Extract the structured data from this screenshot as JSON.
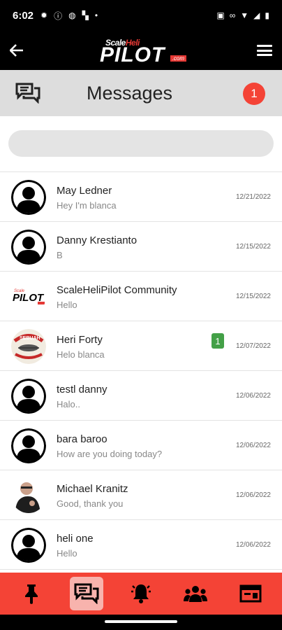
{
  "status": {
    "time": "6:02"
  },
  "app_bar": {
    "logo_top_a": "Scale",
    "logo_top_b": "Heli",
    "logo_main": "PILOT",
    "logo_com": ".com"
  },
  "header": {
    "title": "Messages",
    "badge": "1"
  },
  "search": {
    "placeholder": "",
    "value": ""
  },
  "conversations": [
    {
      "name": "May Ledner",
      "preview": "Hey I'm blanca",
      "date": "12/21/2022",
      "avatar": "silhouette",
      "unread": ""
    },
    {
      "name": "Danny Krestianto",
      "preview": "B",
      "date": "12/15/2022",
      "avatar": "silhouette",
      "unread": ""
    },
    {
      "name": "ScaleHeliPilot Community",
      "preview": "Hello",
      "date": "12/15/2022",
      "avatar": "logo",
      "unread": ""
    },
    {
      "name": "Heri Forty",
      "preview": "Helo blanca",
      "date": "12/07/2022",
      "avatar": "emblem",
      "unread": "1"
    },
    {
      "name": "testl danny",
      "preview": "Halo..",
      "date": "12/06/2022",
      "avatar": "silhouette",
      "unread": ""
    },
    {
      "name": "bara baroo",
      "preview": "How are you doing today?",
      "date": "12/06/2022",
      "avatar": "silhouette",
      "unread": ""
    },
    {
      "name": "Michael Kranitz",
      "preview": "Good, thank you",
      "date": "12/06/2022",
      "avatar": "photo",
      "unread": ""
    },
    {
      "name": "heli one",
      "preview": "Hello",
      "date": "12/06/2022",
      "avatar": "silhouette",
      "unread": ""
    }
  ],
  "emblem_text": "SEBUAH",
  "nav": [
    {
      "icon": "pin-icon",
      "active": false
    },
    {
      "icon": "messages-icon",
      "active": true
    },
    {
      "icon": "alarm-bell-icon",
      "active": false
    },
    {
      "icon": "people-icon",
      "active": false
    },
    {
      "icon": "browser-window-icon",
      "active": false
    }
  ],
  "colors": {
    "accent": "#f44336",
    "unread": "#43a047",
    "header_bg": "#dddddd"
  }
}
